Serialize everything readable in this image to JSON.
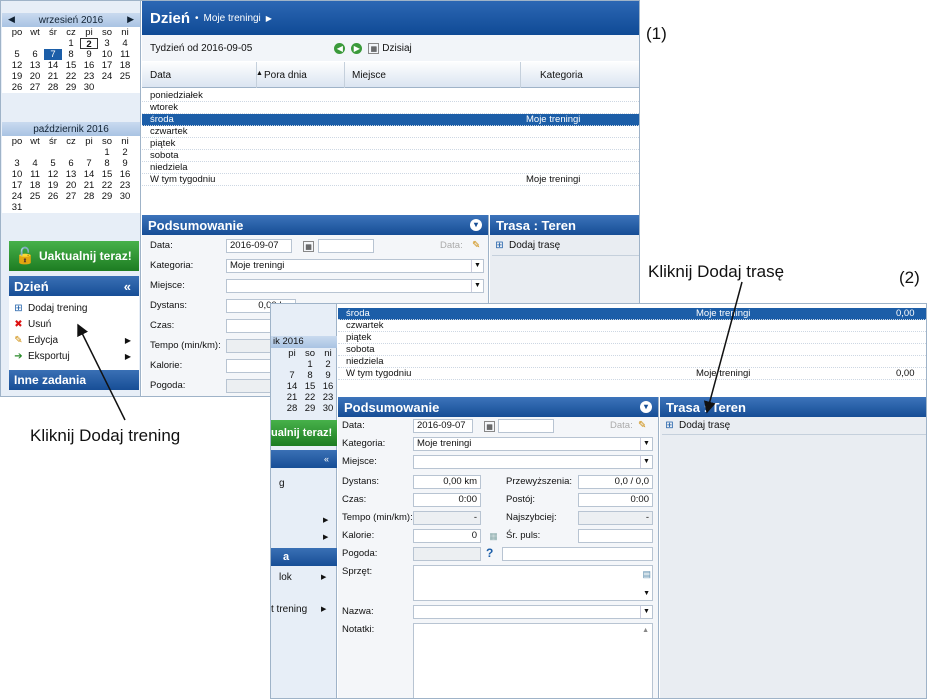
{
  "annotations": {
    "label1": "(1)",
    "label2": "(2)",
    "callout_add_training": "Kliknij Dodaj trening",
    "callout_add_route": "Kliknij Dodaj trasę"
  },
  "calendar": {
    "sep_title": "wrzesień 2016",
    "oct_title": "październik 2016",
    "days": [
      "po",
      "wt",
      "śr",
      "cz",
      "pi",
      "so",
      "ni"
    ],
    "sep_rows": [
      [
        "",
        "",
        "",
        "1",
        "2",
        "3",
        "4"
      ],
      [
        "5",
        "6",
        "7",
        "8",
        "9",
        "10",
        "11"
      ],
      [
        "12",
        "13",
        "14",
        "15",
        "16",
        "17",
        "18"
      ],
      [
        "19",
        "20",
        "21",
        "22",
        "23",
        "24",
        "25"
      ],
      [
        "26",
        "27",
        "28",
        "29",
        "30",
        "",
        ""
      ]
    ],
    "oct_rows": [
      [
        "",
        "",
        "",
        "",
        "",
        "1",
        "2"
      ],
      [
        "3",
        "4",
        "5",
        "6",
        "7",
        "8",
        "9"
      ],
      [
        "10",
        "11",
        "12",
        "13",
        "14",
        "15",
        "16"
      ],
      [
        "17",
        "18",
        "19",
        "20",
        "21",
        "22",
        "23"
      ],
      [
        "24",
        "25",
        "26",
        "27",
        "28",
        "29",
        "30"
      ],
      [
        "31",
        "",
        "",
        "",
        "",
        "",
        ""
      ]
    ]
  },
  "left": {
    "update_btn": "Uaktualnij teraz!",
    "day_section": "Dzień",
    "menu": [
      "Dodaj trening",
      "Usuń",
      "Edycja",
      "Eksportuj"
    ],
    "other_section": "Inne zadania"
  },
  "main": {
    "title": "Dzień",
    "crumb": "Moje treningi",
    "week": "Tydzień od 2016-09-05",
    "today_btn": "Dzisiaj",
    "columns": [
      "Data",
      "Pora dnia",
      "Miejsce",
      "Kategoria"
    ],
    "rows": [
      {
        "day": "poniedziałek",
        "cat": ""
      },
      {
        "day": "wtorek",
        "cat": ""
      },
      {
        "day": "środa",
        "cat": "Moje treningi"
      },
      {
        "day": "czwartek",
        "cat": ""
      },
      {
        "day": "piątek",
        "cat": ""
      },
      {
        "day": "sobota",
        "cat": ""
      },
      {
        "day": "niedziela",
        "cat": ""
      },
      {
        "day": "W tym tygodniu",
        "cat": "Moje treningi"
      }
    ]
  },
  "summary": {
    "title": "Podsumowanie",
    "date_lbl": "Data:",
    "date": "2016-09-07",
    "date2_lbl": "Data:",
    "cat_lbl": "Kategoria:",
    "cat": "Moje treningi",
    "place_lbl": "Miejsce:",
    "dist_lbl": "Dystans:",
    "dist": "0,00 km",
    "dist_short": "0,00 km",
    "time_lbl": "Czas:",
    "time": "0:00",
    "tempo_lbl": "Tempo (min/km):",
    "tempo": "-",
    "cal_lbl": "Kalorie:",
    "cal": "0",
    "weather_lbl": "Pogoda:",
    "climb_lbl": "Przewyższenia:",
    "climb": "0,0 / 0,0",
    "stop_lbl": "Postój:",
    "stop": "0:00",
    "fast_lbl": "Najszybciej:",
    "fast": "-",
    "hr_lbl": "Śr. puls:",
    "gear_lbl": "Sprzęt:",
    "name_lbl": "Nazwa:",
    "notes_lbl": "Notatki:"
  },
  "route": {
    "title": "Trasa : Teren",
    "add": "Dodaj trasę"
  },
  "s2": {
    "rows": [
      {
        "day": "środa",
        "cat": "Moje treningi",
        "val": "0,00"
      },
      {
        "day": "czwartek",
        "cat": "",
        "val": ""
      },
      {
        "day": "piątek",
        "cat": "",
        "val": ""
      },
      {
        "day": "sobota",
        "cat": "",
        "val": ""
      },
      {
        "day": "niedziela",
        "cat": "",
        "val": ""
      },
      {
        "day": "W tym tygodniu",
        "cat": "Moje treningi",
        "val": "0,00"
      }
    ],
    "peek_month": "ik 2016",
    "peek_days": [
      "pi",
      "so",
      "ni"
    ],
    "peek_rows": [
      [
        "",
        "1",
        "2"
      ],
      [
        "7",
        "8",
        "9"
      ],
      [
        "14",
        "15",
        "16"
      ],
      [
        "21",
        "22",
        "23"
      ],
      [
        "28",
        "29",
        "30"
      ]
    ],
    "peek_update": "ualnij teraz!",
    "peek_g": "g",
    "peek_a": "a",
    "peek_lok": "lok",
    "peek_tren": "t trening"
  }
}
